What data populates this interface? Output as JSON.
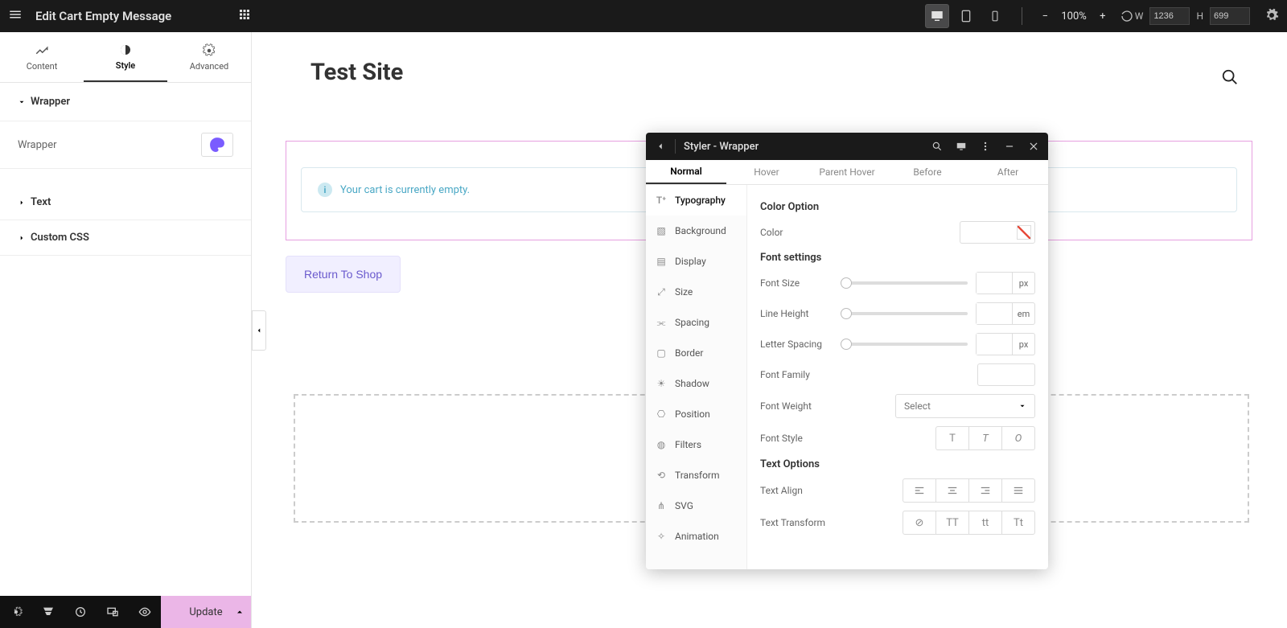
{
  "topbar": {
    "title": "Edit Cart Empty Message",
    "zoom": "100%",
    "w_label": "W",
    "h_label": "H",
    "w_value": "1236",
    "h_value": "699"
  },
  "left_panel": {
    "tabs": {
      "content": "Content",
      "style": "Style",
      "advanced": "Advanced"
    },
    "sections": {
      "wrapper_head": "Wrapper",
      "wrapper_row": "Wrapper",
      "text_head": "Text",
      "css_head": "Custom CSS"
    },
    "update": "Update"
  },
  "canvas": {
    "site_title": "Test Site",
    "notice": "Your cart is currently empty.",
    "return_btn": "Return To Shop"
  },
  "styler": {
    "title": "Styler - Wrapper",
    "tabs": [
      "Normal",
      "Hover",
      "Parent Hover",
      "Before",
      "After"
    ],
    "cats": [
      "Typography",
      "Background",
      "Display",
      "Size",
      "Spacing",
      "Border",
      "Shadow",
      "Position",
      "Filters",
      "Transform",
      "SVG",
      "Animation"
    ],
    "color_option_head": "Color Option",
    "color_label": "Color",
    "font_settings_head": "Font settings",
    "font_size": "Font Size",
    "line_height": "Line Height",
    "letter_spacing": "Letter Spacing",
    "font_family": "Font Family",
    "font_weight": "Font Weight",
    "font_weight_placeholder": "Select",
    "font_style": "Font Style",
    "text_options_head": "Text Options",
    "text_align": "Text Align",
    "text_transform": "Text Transform",
    "units": {
      "px": "px",
      "em": "em"
    }
  }
}
